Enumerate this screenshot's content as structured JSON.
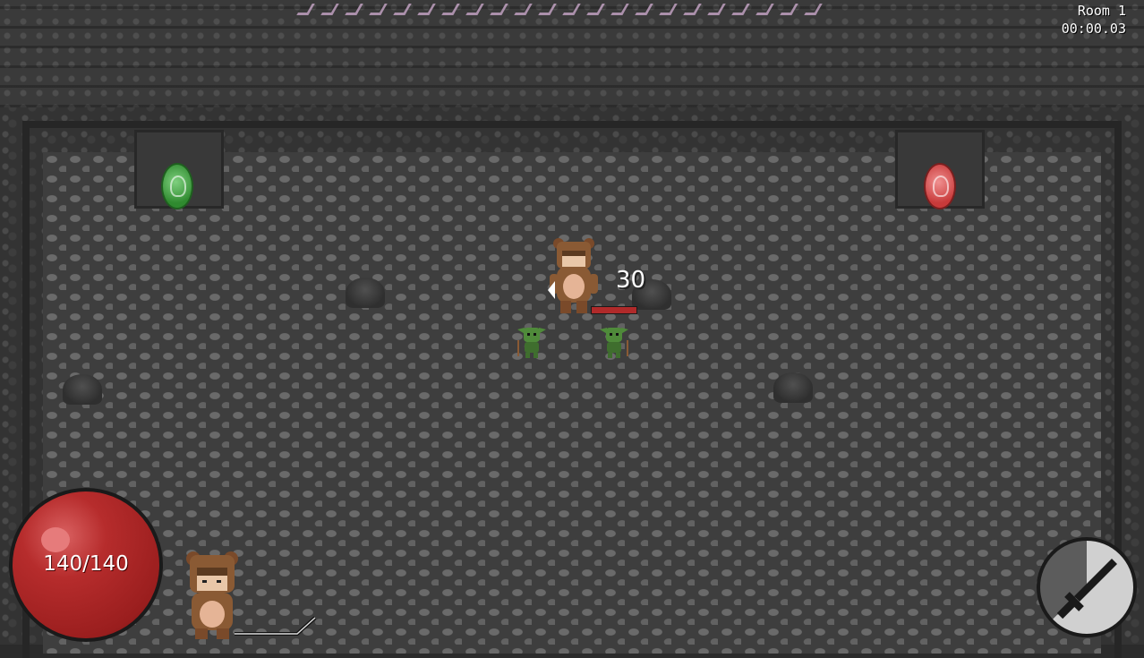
{
  "hud": {
    "room_label": "Room 1",
    "timer": "00:00.03"
  },
  "player": {
    "health_text": "140/140",
    "health_current": 140,
    "health_max": 140,
    "character": "bear-costume-girl"
  },
  "combat": {
    "damage_number": "30",
    "enemy_health_fraction": 1.0
  },
  "room": {
    "portals": [
      "green-portal-icon",
      "red-portal-icon"
    ],
    "enemies": [
      "goblin",
      "goblin"
    ],
    "obstacles": [
      "rock",
      "rock",
      "rock",
      "rock"
    ]
  },
  "weapon": {
    "icon": "sword-icon",
    "cooldown_remaining_fraction": 0.37
  },
  "colors": {
    "health_red": "#b62c2c",
    "portal_green": "#2f8a2f",
    "portal_red": "#c83a3a",
    "goblin_green": "#4f8a3a"
  }
}
